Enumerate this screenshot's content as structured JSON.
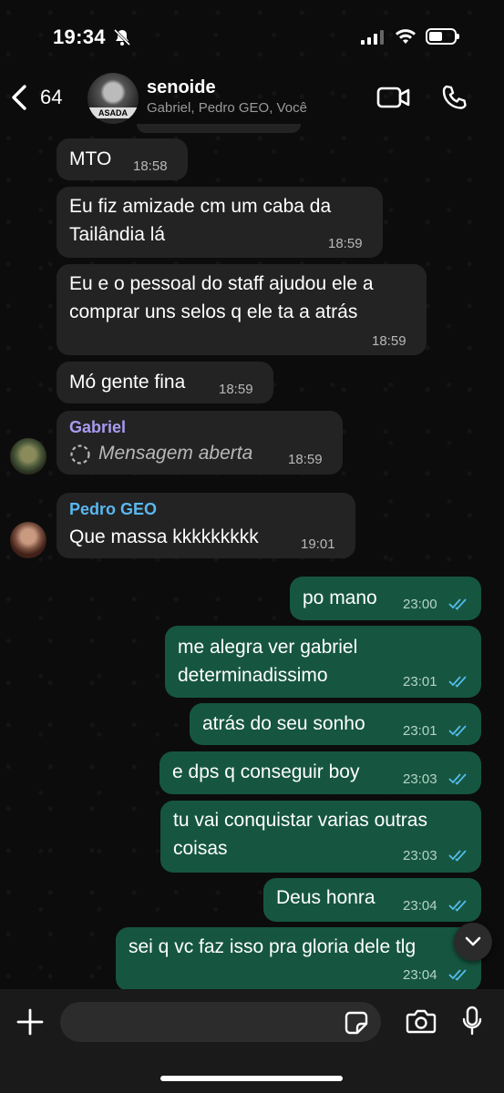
{
  "status_bar": {
    "time": "19:34"
  },
  "header": {
    "back_count": "64",
    "group_name": "senoide",
    "members": "Gabriel, Pedro GEO, Você",
    "avatar_text": "ASADA"
  },
  "messages": [
    {
      "text": "MTO",
      "time": "18:58"
    },
    {
      "line1": "Eu fiz amizade cm um caba da",
      "line2": "Tailândia lá",
      "time": "18:59"
    },
    {
      "line1": "Eu e o pessoal do staff ajudou ele a",
      "line2": "comprar uns selos q ele ta a atrás",
      "time": "18:59"
    },
    {
      "text": "Mó gente fina",
      "time": "18:59"
    },
    {
      "sender": "Gabriel",
      "sender_color": "#a99bf0",
      "text": "Mensagem aberta",
      "time": "18:59"
    },
    {
      "sender": "Pedro GEO",
      "sender_color": "#5ab8f0",
      "text": "Que massa kkkkkkkkk",
      "time": "19:01"
    },
    {
      "text": "po mano",
      "time": "23:00"
    },
    {
      "line1": "me alegra ver gabriel",
      "line2": "determinadissimo",
      "time": "23:01"
    },
    {
      "text": "atrás do seu sonho",
      "time": "23:01"
    },
    {
      "text": "e dps q conseguir boy",
      "time": "23:03"
    },
    {
      "line1": "tu vai conquistar varias outras",
      "line2": "coisas",
      "time": "23:03"
    },
    {
      "text": "Deus honra",
      "time": "23:04"
    },
    {
      "text": "sei q vc faz isso pra gloria dele tlg",
      "time": "23:04"
    }
  ],
  "colors": {
    "incoming": "#232323",
    "outgoing": "#165640",
    "read_ticks": "#53bdeb"
  },
  "icons": [
    "bell-off-icon",
    "signal-icon",
    "wifi-icon",
    "battery-icon",
    "back-chevron-icon",
    "video-call-icon",
    "phone-icon",
    "plus-icon",
    "sticker-icon",
    "camera-icon",
    "mic-icon",
    "chevron-down-icon",
    "read-ticks-icon"
  ]
}
